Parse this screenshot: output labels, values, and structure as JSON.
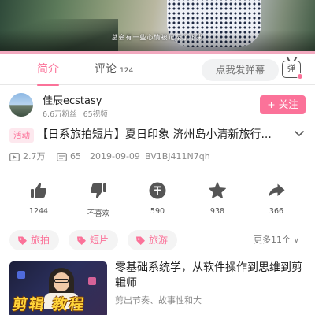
{
  "video": {
    "subtitle": "总会有一些心情被记录了下来"
  },
  "tabs": {
    "intro_label": "简介",
    "comment_label": "评论",
    "comment_count": "124"
  },
  "danmaku": {
    "placeholder": "点我发弹幕",
    "toggle_label": "弹"
  },
  "author": {
    "name": "佳辰ecstasy",
    "followers": "6.6万粉丝",
    "videos": "65视频",
    "follow_label": "+ 关注"
  },
  "video_info": {
    "badge": "活动",
    "title": "【日系旅拍短片】夏日印象  济州岛小清新旅行...",
    "views": "2.7万",
    "danmaku_count": "65",
    "date": "2019-09-09",
    "bvid": "BV1BJ411N7qh"
  },
  "actions": [
    {
      "name": "like",
      "icon": "thumb-up-icon",
      "label": "1244"
    },
    {
      "name": "dislike",
      "icon": "thumb-down-icon",
      "label": "不喜欢"
    },
    {
      "name": "coin",
      "icon": "coin-icon",
      "label": "590"
    },
    {
      "name": "favorite",
      "icon": "star-icon",
      "label": "938"
    },
    {
      "name": "share",
      "icon": "share-arrow-icon",
      "label": "366"
    }
  ],
  "tags": {
    "items": [
      "旅拍",
      "短片",
      "旅游"
    ],
    "more": "更多11个"
  },
  "related": {
    "thumbnail_text": "剪辑 教程",
    "title": "零基础系统学，从软件操作到思维到剪辑师",
    "desc": "剪出节奏、故事性和大"
  },
  "colors": {
    "accent": "#fb7299",
    "icon": "#555555",
    "muted": "#8a8a8a"
  }
}
